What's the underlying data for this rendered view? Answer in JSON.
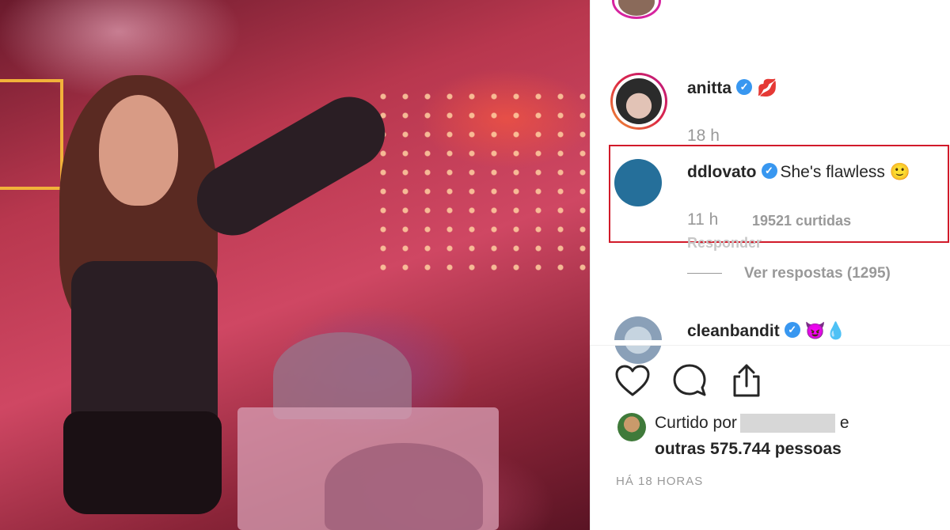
{
  "colors": {
    "verified": "#3897f0",
    "highlight_border": "#d11a2a",
    "ddlovato_avatar": "#256f9a",
    "text_primary": "#262626",
    "text_muted": "#999999"
  },
  "comments": [
    {
      "username": "anitta",
      "emoji": "💋",
      "time": "18 h"
    },
    {
      "username": "ddlovato",
      "text": "She's flawless",
      "emoji": "🙂",
      "time": "11 h",
      "likes": "19521 curtidas",
      "reply": "Responder",
      "view_replies": "Ver respostas (1295)"
    },
    {
      "username": "cleanbandit",
      "emoji": "😈💧"
    }
  ],
  "actions": {
    "like_icon": "heart-outline-icon",
    "comment_icon": "speech-bubble-icon",
    "share_icon": "share-upload-icon"
  },
  "liked_by": {
    "prefix": "Curtido por",
    "suffix": "e",
    "others": "outras 575.744 pessoas"
  },
  "timestamp": "HÁ 18 HORAS"
}
